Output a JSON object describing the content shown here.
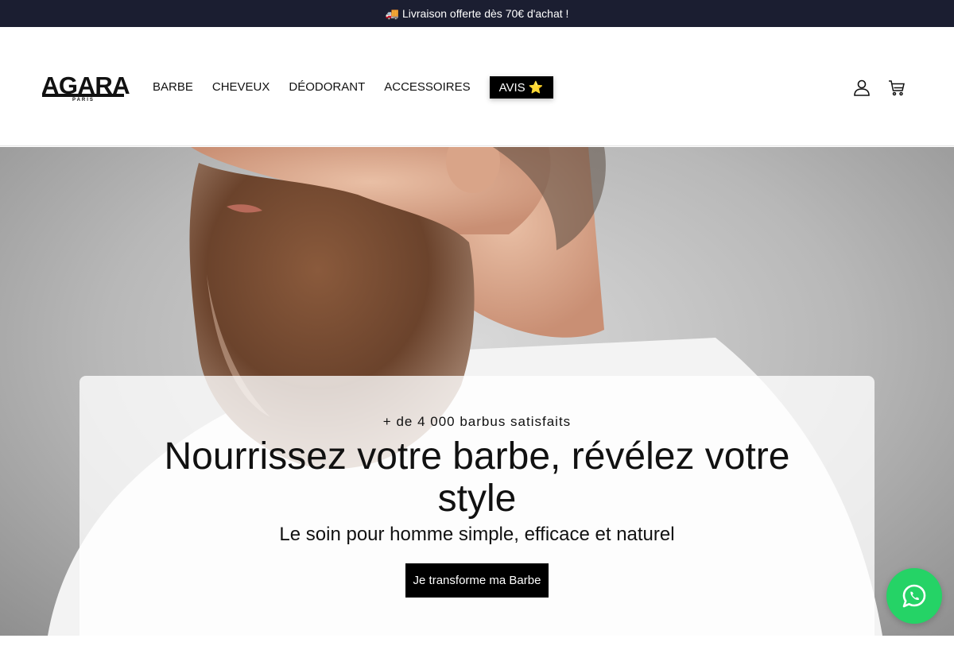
{
  "announcement": {
    "emoji": "🚚",
    "text": "Livraison offerte dès 70€ d'achat !"
  },
  "brand": {
    "name": "AGARA",
    "tagline": "PARIS"
  },
  "nav": [
    {
      "label": "BARBE"
    },
    {
      "label": "CHEVEUX"
    },
    {
      "label": "DÉODORANT"
    },
    {
      "label": "ACCESSOIRES"
    },
    {
      "label": "AVIS ⭐"
    }
  ],
  "header_icons": {
    "account": "user-icon",
    "cart": "cart-icon"
  },
  "hero": {
    "eyebrow": "+ de 4 000 barbus satisfaits",
    "headline": "Nourrissez votre barbe, révélez votre style",
    "subheadline": "Le soin pour homme simple, efficace et naturel",
    "cta": "Je transforme ma Barbe"
  },
  "floating": {
    "icon": "whatsapp-icon"
  },
  "colors": {
    "announcement_bg": "#1b1e31",
    "cta_bg": "#000000",
    "whatsapp": "#25d366"
  }
}
